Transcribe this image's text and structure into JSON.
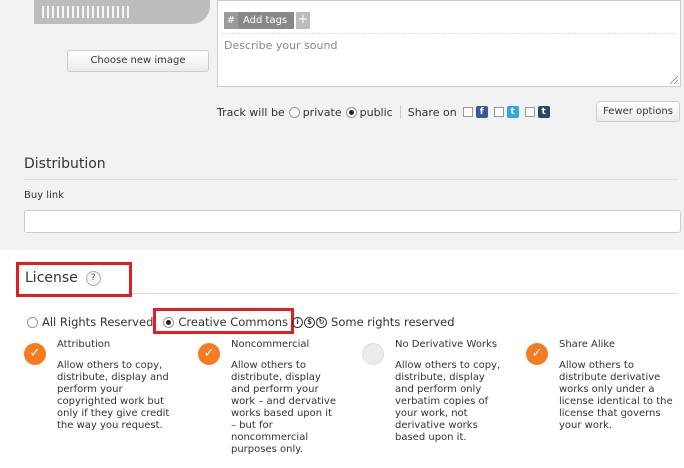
{
  "upload": {
    "choose_image_label": "Choose new image"
  },
  "tags": {
    "hash": "#",
    "placeholder": "Add tags",
    "add": "+"
  },
  "description": {
    "placeholder": "Describe your sound"
  },
  "track": {
    "prefix": "Track will be",
    "private_label": "private",
    "public_label": "public",
    "selected": "public",
    "share_label": "Share on",
    "facebook_glyph": "f",
    "twitter_glyph": "t",
    "tumblr_glyph": "t",
    "fewer_options_label": "Fewer options"
  },
  "distribution": {
    "title": "Distribution",
    "buy_link_label": "Buy link",
    "buy_link_value": ""
  },
  "license": {
    "title": "License",
    "help": "?",
    "options": {
      "all_rights": "All Rights Reserved",
      "creative_commons": "Creative Commons",
      "some_rights": "Some rights reserved",
      "selected": "creative_commons"
    },
    "columns": [
      {
        "title": "Attribution",
        "checked": true,
        "text": "Allow others to copy,\ndistribute, display and\nperform your\ncopyrighted work but\nonly if they give credit\nthe way you request."
      },
      {
        "title": "Noncommercial",
        "checked": true,
        "text": "Allow others to\ndistribute, display\nand perform your\nwork – and dervative\nworks based upon it\n– but for\nnoncommercial\npurposes only."
      },
      {
        "title": "No Derivative Works",
        "checked": false,
        "text": "Allow others to copy,\ndistribute, display\nand perform only\nverbatim copies of\nyour work, not\nderivative works\nbased upon it."
      },
      {
        "title": "Share Alike",
        "checked": true,
        "text": "Allow others to\ndistribute derivative\nworks only under a\nlicense identical to the\nlicense that governs\nyour work."
      }
    ]
  },
  "colors": {
    "accent_orange": "#f47b20",
    "highlight_red": "#e02020",
    "panel_gray": "#f2f2f2"
  }
}
